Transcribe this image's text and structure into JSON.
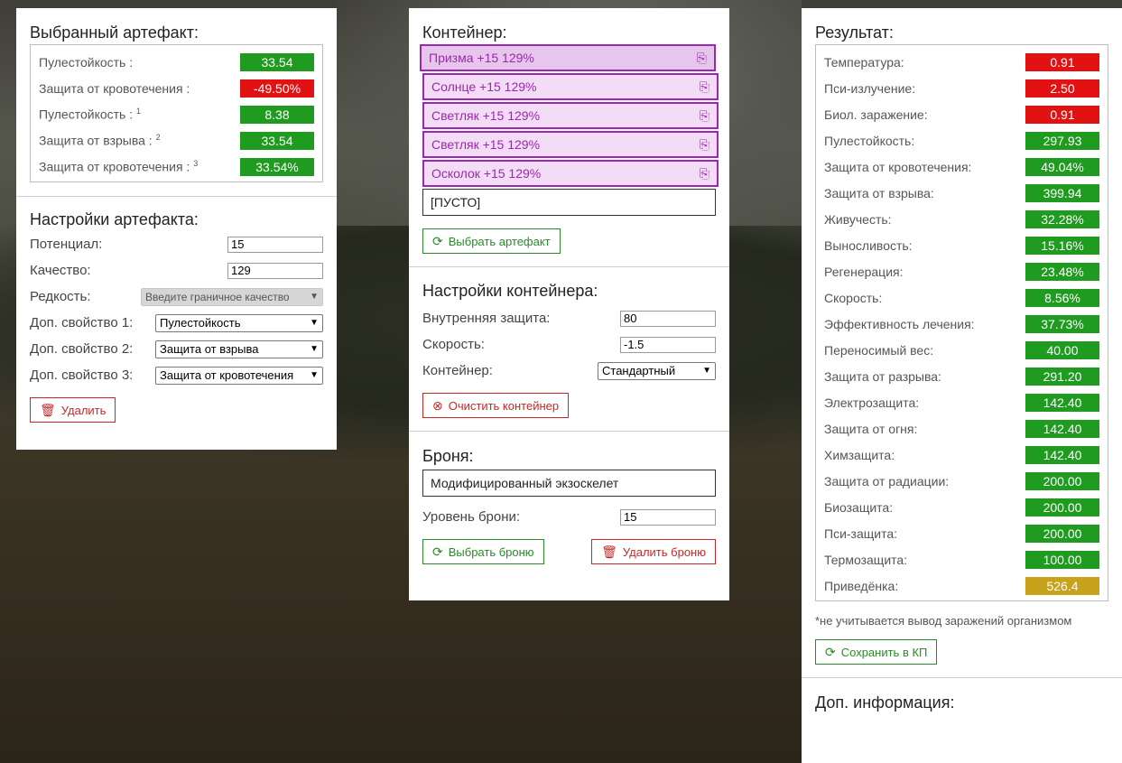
{
  "artifact_panel": {
    "title": "Выбранный артефакт:",
    "stats": [
      {
        "label": "Пулестойкость :",
        "sup": "",
        "value": "33.54",
        "color": "#1f9b1f"
      },
      {
        "label": "Защита от кровотечения :",
        "sup": "",
        "value": "-49.50%",
        "color": "#e31212"
      },
      {
        "label": "Пулестойкость :",
        "sup": "1",
        "value": "8.38",
        "color": "#1f9b1f"
      },
      {
        "label": "Защита от взрыва :",
        "sup": "2",
        "value": "33.54",
        "color": "#1f9b1f"
      },
      {
        "label": "Защита от кровотечения :",
        "sup": "3",
        "value": "33.54%",
        "color": "#1f9b1f"
      }
    ],
    "settings_title": "Настройки артефакта:",
    "potential_label": "Потенциал:",
    "potential_value": "15",
    "quality_label": "Качество:",
    "quality_value": "129",
    "rarity_label": "Редкость:",
    "rarity_value": "Введите граничное качество",
    "extra1_label": "Доп. свойство 1:",
    "extra1_value": "Пулестойкость",
    "extra2_label": "Доп. свойство 2:",
    "extra2_value": "Защита от взрыва",
    "extra3_label": "Доп. свойство 3:",
    "extra3_value": "Защита от кровотечения",
    "delete_label": "Удалить"
  },
  "container_panel": {
    "title": "Контейнер:",
    "slots": [
      {
        "label": "Призма +15 129%"
      },
      {
        "label": "Солнце +15 129%"
      },
      {
        "label": "Светляк +15 129%"
      },
      {
        "label": "Светляк +15 129%"
      },
      {
        "label": "Осколок +15 129%"
      }
    ],
    "empty_slot": "[ПУСТО]",
    "choose_artifact": "Выбрать артефакт",
    "settings_title": "Настройки контейнера:",
    "inner_protection_label": "Внутренняя защита:",
    "inner_protection_value": "80",
    "speed_label": "Скорость:",
    "speed_value": "-1.5",
    "container_label": "Контейнер:",
    "container_value": "Стандартный",
    "clear_label": "Очистить контейнер",
    "armor_title": "Броня:",
    "armor_name": "Модифицированный экзоскелет",
    "armor_level_label": "Уровень брони:",
    "armor_level_value": "15",
    "choose_armor": "Выбрать броню",
    "delete_armor": "Удалить броню"
  },
  "result_panel": {
    "title": "Результат:",
    "stats": [
      {
        "label": "Температура:",
        "value": "0.91",
        "color": "#e31212"
      },
      {
        "label": "Пси-излучение:",
        "value": "2.50",
        "color": "#e31212"
      },
      {
        "label": "Биол. заражение:",
        "value": "0.91",
        "color": "#e31212"
      },
      {
        "label": "Пулестойкость:",
        "value": "297.93",
        "color": "#1f9b1f"
      },
      {
        "label": "Защита от кровотечения:",
        "value": "49.04%",
        "color": "#1f9b1f"
      },
      {
        "label": "Защита от взрыва:",
        "value": "399.94",
        "color": "#1f9b1f"
      },
      {
        "label": "Живучесть:",
        "value": "32.28%",
        "color": "#1f9b1f"
      },
      {
        "label": "Выносливость:",
        "value": "15.16%",
        "color": "#1f9b1f"
      },
      {
        "label": "Регенерация:",
        "value": "23.48%",
        "color": "#1f9b1f"
      },
      {
        "label": "Скорость:",
        "value": "8.56%",
        "color": "#1f9b1f"
      },
      {
        "label": "Эффективность лечения:",
        "value": "37.73%",
        "color": "#1f9b1f"
      },
      {
        "label": "Переносимый вес:",
        "value": "40.00",
        "color": "#1f9b1f"
      },
      {
        "label": "Защита от разрыва:",
        "value": "291.20",
        "color": "#1f9b1f"
      },
      {
        "label": "Электрозащита:",
        "value": "142.40",
        "color": "#1f9b1f"
      },
      {
        "label": "Защита от огня:",
        "value": "142.40",
        "color": "#1f9b1f"
      },
      {
        "label": "Химзащита:",
        "value": "142.40",
        "color": "#1f9b1f"
      },
      {
        "label": "Защита от радиации:",
        "value": "200.00",
        "color": "#1f9b1f"
      },
      {
        "label": "Биозащита:",
        "value": "200.00",
        "color": "#1f9b1f"
      },
      {
        "label": "Пси-защита:",
        "value": "200.00",
        "color": "#1f9b1f"
      },
      {
        "label": "Термозащита:",
        "value": "100.00",
        "color": "#1f9b1f"
      },
      {
        "label": "Приведёнка:",
        "value": "526.4",
        "color": "#c7a21a"
      }
    ],
    "note": "*не учитывается вывод заражений организмом",
    "save_label": "Сохранить в КП",
    "extra_title": "Доп. информация:"
  }
}
